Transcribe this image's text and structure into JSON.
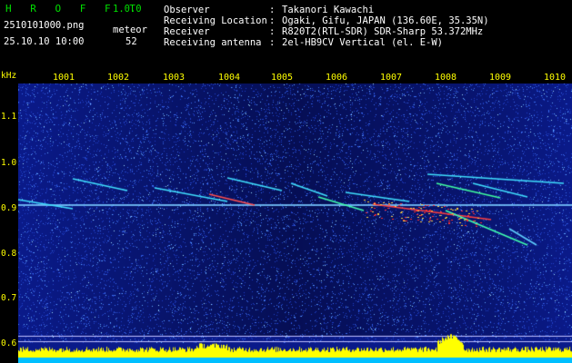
{
  "app": {
    "name": "H R O F F T",
    "version": "1.0.0"
  },
  "file": {
    "filename": "2510101000.png",
    "datetime": "25.10.10 10:00",
    "meteor_label": "meteor",
    "meteor_count": "52"
  },
  "info": [
    {
      "label": "Observer",
      "sep": ":",
      "value": "Takanori Kawachi"
    },
    {
      "label": "Receiving Location",
      "sep": ":",
      "value": "Ogaki, Gifu, JAPAN (136.60E, 35.35N)"
    },
    {
      "label": "Receiver",
      "sep": ":",
      "value": "R820T2(RTL-SDR) SDR-Sharp 53.372MHz"
    },
    {
      "label": "Receiving antenna",
      "sep": ":",
      "value": "2el-HB9CV Vertical (el. E-W)"
    }
  ],
  "axis": {
    "y_unit": "kHz",
    "x_ticks": [
      "1001",
      "1002",
      "1003",
      "1004",
      "1005",
      "1006",
      "1007",
      "1008",
      "1009",
      "1010"
    ],
    "y_ticks": [
      "1.1",
      "1.0",
      "0.9",
      "0.8",
      "0.7",
      "0.6"
    ]
  },
  "colors": {
    "background": "#000000",
    "spectro_base": "#0a1a8a",
    "text_green": "#00e000",
    "text_yellow": "#ffff00",
    "text_white": "#ffffff",
    "signal_cyan": "#00ffff",
    "signal_hot": "#ff4040",
    "noise_bar": "#ffff00",
    "noise_bar_base": "#00bfff"
  }
}
